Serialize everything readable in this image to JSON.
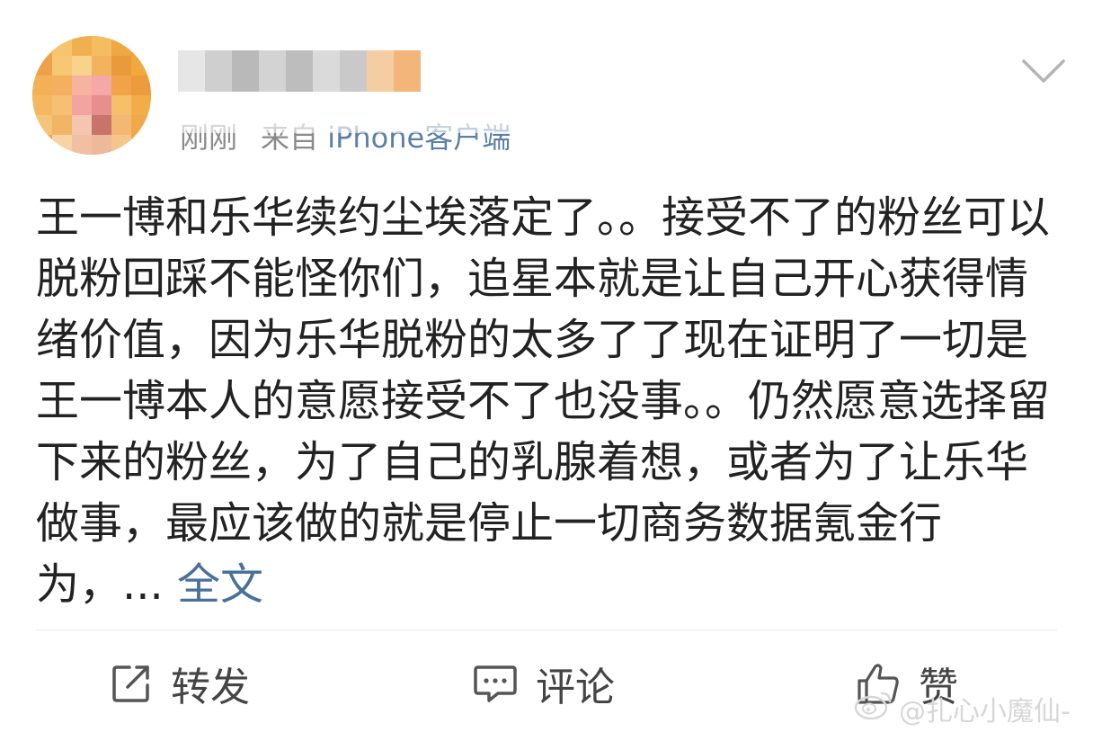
{
  "post": {
    "username": "",
    "meta": {
      "time": "刚刚",
      "source_prefix": "来自",
      "source_app": "iPhone客户端"
    },
    "body_text": "王一博和乐华续约尘埃落定了。。接受不了的粉丝可以脱粉回踩不能怪你们，追星本就是让自己开心获得情绪价值，因为乐华脱粉的太多了了现在证明了一切是王一博本人的意愿接受不了也没事。。仍然愿意选择留下来的粉丝，为了自己的乳腺着想，或者为了让乐华做事，最应该做的就是停止一切商务数据氪金行为，... ",
    "read_more": "全文"
  },
  "actions": {
    "repost_label": "转发",
    "comment_label": "评论",
    "like_label": "赞"
  },
  "watermark": {
    "text": "@扎心小魔仙-"
  },
  "icons": {
    "chevron": "chevron-down-icon",
    "repost": "repost-icon",
    "comment": "comment-icon",
    "like": "thumbs-up-icon",
    "weibo": "weibo-logo-icon"
  },
  "colors": {
    "link": "#4a6f9a",
    "text": "#222222",
    "meta": "#8a8a8a"
  }
}
